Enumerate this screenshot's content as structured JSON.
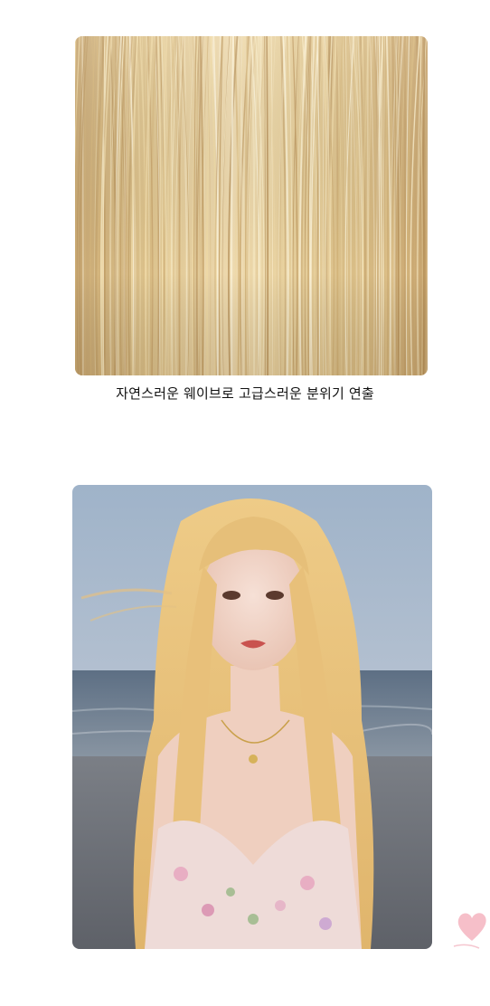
{
  "caption": "자연스러운 웨이브로 고급스러운 분위기 연출",
  "colors": {
    "hair_light": "#f3e2b0",
    "hair_mid": "#d8bd84",
    "hair_dark": "#b99662",
    "sky_top": "#a7b8cc",
    "sky_bottom": "#c8cdd6",
    "sea": "#6b7c8e",
    "model_hair": "#e9c27a",
    "skin": "#f0d3c4",
    "heart": "#f5b8c3"
  },
  "icons": {
    "decoration": "heart-icon"
  }
}
